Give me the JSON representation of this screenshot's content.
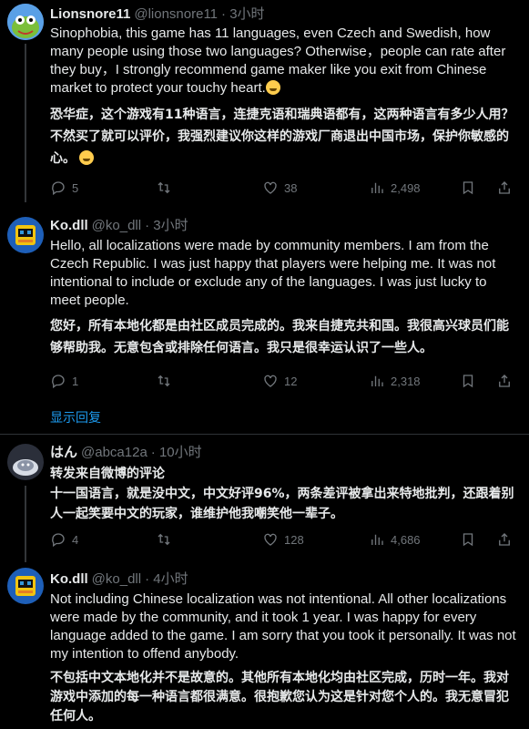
{
  "tweets": [
    {
      "name": "Lionsnore11",
      "handle": "@lionsnore11",
      "time": "· 3小时",
      "text_en": "Sinophobia, this game has 11 languages, even Czech and Swedish, how many people using those two languages?  Otherwise，people can rate after they buy，I strongly recommend game maker like you exit from Chinese market to protect your touchy heart.",
      "text_zh": "恐华症，这个游戏有11种语言，连捷克语和瑞典语都有，这两种语言有多少人用？不然买了就可以评价，我强烈建议你这样的游戏厂商退出中国市场，保护你敏感的心。",
      "replies": "5",
      "likes": "38",
      "views": "2,498"
    },
    {
      "name": "Ko.dll",
      "handle": "@ko_dll",
      "time": "· 3小时",
      "text_en": "Hello, all localizations were made by community members. I am from the Czech Republic. I was just happy that players were helping me. It was not intentional to include or exclude any of the languages. I was just lucky to meet people.",
      "text_zh": "您好，所有本地化都是由社区成员完成的。我来自捷克共和国。我很高兴球员们能够帮助我。无意包含或排除任何语言。我只是很幸运认识了一些人。",
      "replies": "1",
      "likes": "12",
      "views": "2,318"
    },
    {
      "name": "はん",
      "handle": "@abca12a",
      "time": "· 10小时",
      "text_zh": "转发来自微博的评论\n十一国语言，就是没中文，中文好评96%，两条差评被拿出来特地批判，还跟着别人一起笑要中文的玩家，谁维护他我嘲笑他一辈子。",
      "replies": "4",
      "likes": "128",
      "views": "4,686"
    },
    {
      "name": "Ko.dll",
      "handle": "@ko_dll",
      "time": "· 4小时",
      "text_en": "Not including Chinese localization was not intentional. All other localizations were made by the community, and it took 1 year. I was happy for every language added to the game. I am sorry that you took it personally. It was not my intention to offend anybody.",
      "text_zh": "不包括中文本地化并不是故意的。其他所有本地化均由社区完成，历时一年。我对游戏中添加的每一种语言都很满意。很抱歉您认为这是针对您个人的。我无意冒犯任何人。"
    }
  ],
  "show_replies": "显示回复",
  "colors": {
    "background": "#000000",
    "text": "#e7e9ea",
    "muted": "#71767b",
    "link": "#1d9bf0",
    "divider": "#2f3336"
  },
  "icons": [
    "reply-icon",
    "retweet-icon",
    "like-icon",
    "views-icon",
    "bookmark-icon",
    "share-icon"
  ]
}
